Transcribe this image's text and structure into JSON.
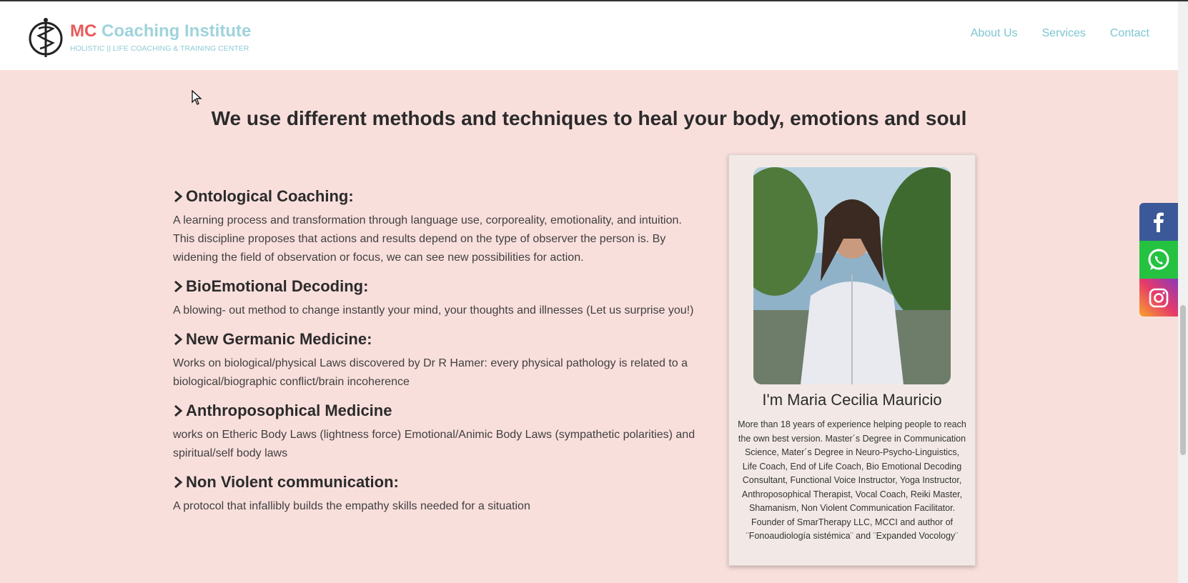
{
  "header": {
    "logo_mc": "MC",
    "logo_name": "Coaching Institute",
    "logo_tagline": "HOLISTIC || LIFE COACHING & TRAINING CENTER",
    "nav": [
      {
        "label": "About Us"
      },
      {
        "label": "Services"
      },
      {
        "label": "Contact"
      }
    ]
  },
  "main": {
    "headline": "We use different methods and techniques to heal your body, emotions and soul",
    "methods": [
      {
        "title": "Ontological Coaching:",
        "description": "A learning process and transformation through language use, corporeality, emotionality, and intuition. This discipline proposes that actions and results depend on the type of observer the person is. By widening the field of observation or focus, we can see new possibilities for action."
      },
      {
        "title": "BioEmotional Decoding:",
        "description": "A blowing- out method to change instantly your mind, your thoughts and illnesses (Let us surprise you!)"
      },
      {
        "title": "New Germanic Medicine:",
        "description": "Works on biological/physical Laws discovered by Dr R Hamer: every physical pathology is related to a biological/biographic conflict/brain incoherence"
      },
      {
        "title": "Anthroposophical Medicine",
        "description": "works on Etheric Body Laws (lightness force) Emotional/Animic Body Laws (sympathetic polarities) and spiritual/self body laws"
      },
      {
        "title": "Non Violent communication:",
        "description": "A protocol that infallibly builds the empathy skills needed for a situation"
      }
    ],
    "profile": {
      "name": "I'm Maria Cecilia Mauricio",
      "bio": "More than 18 years of experience helping people to reach the own best version. Master´s Degree in Communication Science, Mater´s Degree in Neuro-Psycho-Linguistics, Life Coach, End of Life Coach, Bio Emotional Decoding Consultant, Functional Voice Instructor, Yoga Instructor, Anthroposophical Therapist, Vocal Coach, Reiki Master, Shamanism, Non Violent Communication Facilitator. Founder of SmarTherapy LLC, MCCI and author of ¨Fonoaudiología sistémica¨ and ¨Expanded Vocology¨"
    }
  },
  "social": [
    {
      "icon": "facebook-icon",
      "color": "#3b5998"
    },
    {
      "icon": "whatsapp-icon",
      "color": "#25c242"
    },
    {
      "icon": "instagram-icon",
      "color": "#e63a6a"
    }
  ],
  "colors": {
    "page_bg": "#f9dfdc",
    "accent": "#7cc6d2",
    "logo_red": "#e85a5a",
    "card_bg": "#f2e9e6"
  }
}
